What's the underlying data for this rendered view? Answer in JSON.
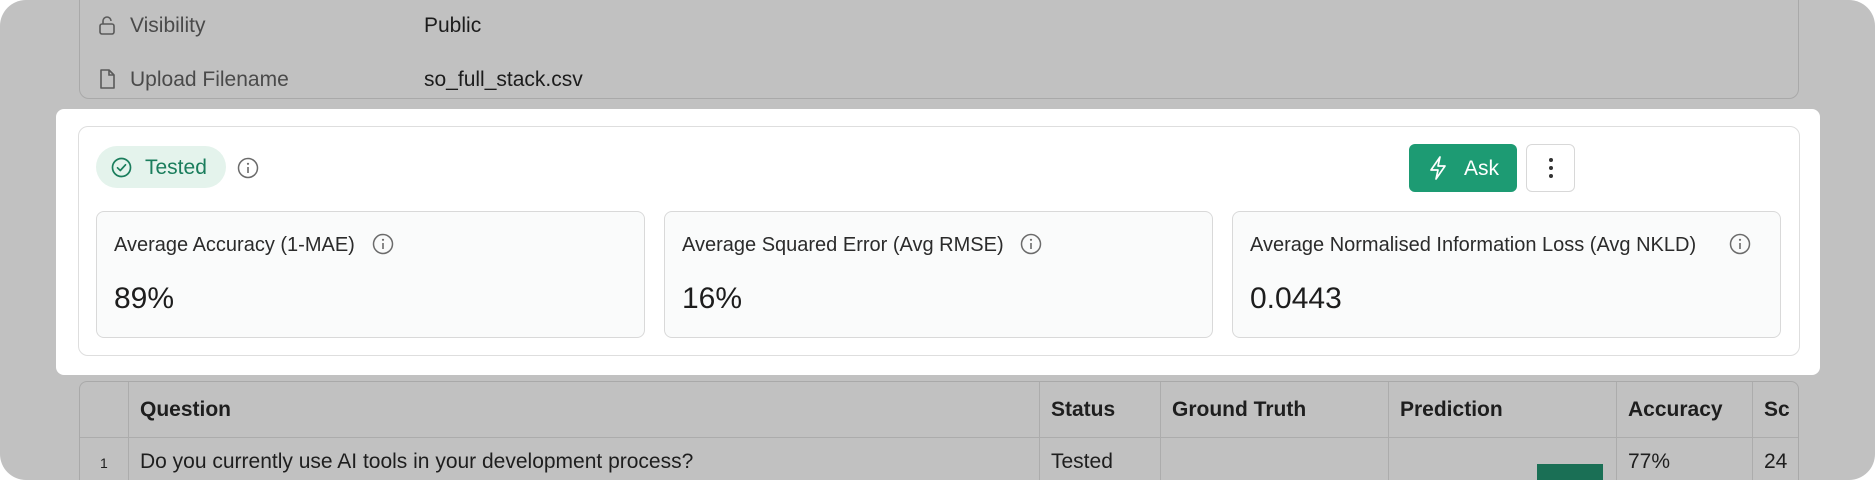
{
  "details": {
    "visibility_label": "Visibility",
    "visibility_value": "Public",
    "filename_label": "Upload Filename",
    "filename_value": "so_full_stack.csv"
  },
  "status": {
    "badge_label": "Tested",
    "ask_label": "Ask"
  },
  "metrics": [
    {
      "label": "Average Accuracy (1-MAE)",
      "value": "89%"
    },
    {
      "label": "Average Squared Error (Avg RMSE)",
      "value": "16%"
    },
    {
      "label": "Average Normalised Information Loss (Avg NKLD)",
      "value": "0.0443"
    }
  ],
  "table": {
    "columns": [
      "Question",
      "Status",
      "Ground Truth",
      "Prediction",
      "Accuracy",
      "Sc"
    ],
    "rows": [
      {
        "index": "1",
        "question": "Do you currently use AI tools in your development process?",
        "status": "Tested",
        "accuracy": "77%",
        "score": "24"
      }
    ]
  },
  "colors": {
    "accent": "#1d9b73",
    "badge_bg": "#e4f3ec",
    "badge_text": "#1a7d5c",
    "overlay": "#c1c1c1"
  }
}
